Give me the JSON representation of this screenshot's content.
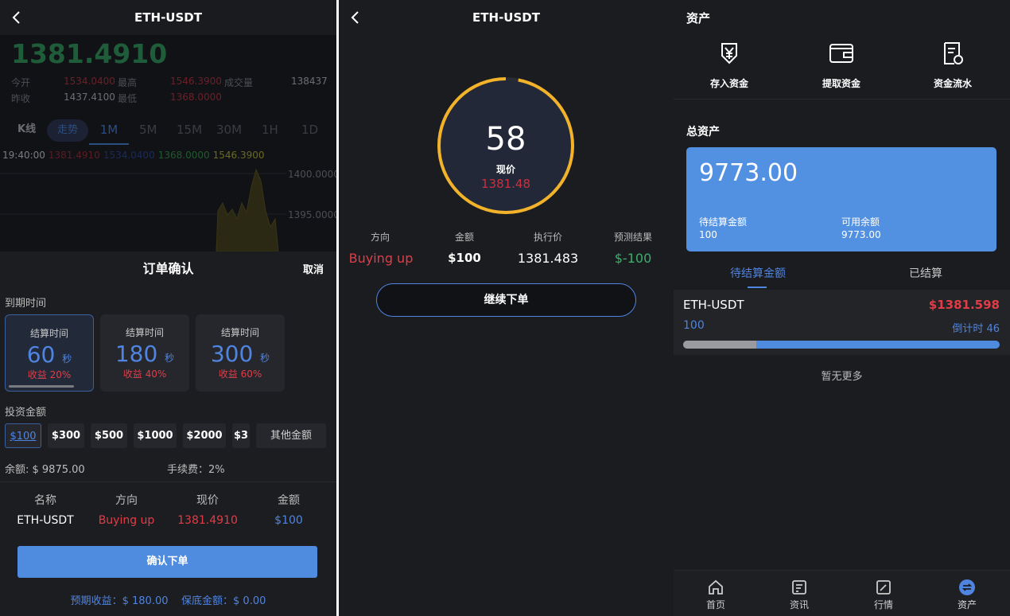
{
  "panel1": {
    "title": "ETH-USDT",
    "price": "1381.4910",
    "stats": {
      "open_label": "今开",
      "open": "1534.0400",
      "high_label": "最高",
      "high": "1546.3900",
      "vol_label": "成交量",
      "vol": "138437",
      "prev_label": "昨收",
      "prev": "1437.4100",
      "low_label": "最低",
      "low": "1368.0000"
    },
    "tabs": [
      "K线",
      "走势",
      "1M",
      "5M",
      "15M",
      "30M",
      "1H",
      "1D"
    ],
    "chart_info": {
      "time": "19:40:00",
      "v1": "1381.4910",
      "v2": "1534.0400",
      "v3": "1368.0000",
      "v4": "1546.3900",
      "tick1": "1400.0000",
      "tick2": "1395.0000"
    },
    "sheet": {
      "title": "订单确认",
      "cancel": "取消",
      "expiry_label": "到期时间",
      "cards": [
        {
          "title": "结算时间",
          "value": "60",
          "unit": "秒",
          "profit": "收益 20%"
        },
        {
          "title": "结算时间",
          "value": "180",
          "unit": "秒",
          "profit": "收益 40%"
        },
        {
          "title": "结算时间",
          "value": "300",
          "unit": "秒",
          "profit": "收益 60%"
        }
      ],
      "invest_label": "投资金额",
      "amounts": [
        "$100",
        "$300",
        "$500",
        "$1000",
        "$2000",
        "$3"
      ],
      "other_amount": "其他金额",
      "balance": "余额: $ 9875.00",
      "fee": "手续费：2%",
      "table_headers": [
        "名称",
        "方向",
        "现价",
        "金额"
      ],
      "table_values": [
        "ETH-USDT",
        "Buying up",
        "1381.4910",
        "$100"
      ],
      "confirm": "确认下单",
      "expected": "预期收益：$ 180.00    保底金额：$ 0.00"
    }
  },
  "panel2": {
    "title": "ETH-USDT",
    "countdown": "58",
    "countdown_progress": 0.97,
    "price_label": "现价",
    "price": "1381.48",
    "headers": [
      "方向",
      "金额",
      "执行价",
      "预测结果"
    ],
    "values": [
      "Buying up",
      "$100",
      "1381.483",
      "$-100"
    ],
    "continue": "继续下单"
  },
  "panel3": {
    "title": "资产",
    "actions": [
      "存入资金",
      "提取资金",
      "资金流水"
    ],
    "total_label": "总资产",
    "total": "9773.00",
    "pending_label": "待结算金额",
    "pending": "100",
    "available_label": "可用余额",
    "available": "9773.00",
    "tabs": [
      "待结算金额",
      "已结算"
    ],
    "order": {
      "pair": "ETH-USDT",
      "price": "$1381.598",
      "amount": "100",
      "countdown": "倒计时 46",
      "progress": 0.23
    },
    "no_more": "暂无更多",
    "nav": [
      "首页",
      "资讯",
      "行情",
      "资产"
    ]
  },
  "colors": {
    "accent": "#4f84e0",
    "red": "#e23c47",
    "green": "#3fae6b",
    "ring": "#f2b32a"
  }
}
